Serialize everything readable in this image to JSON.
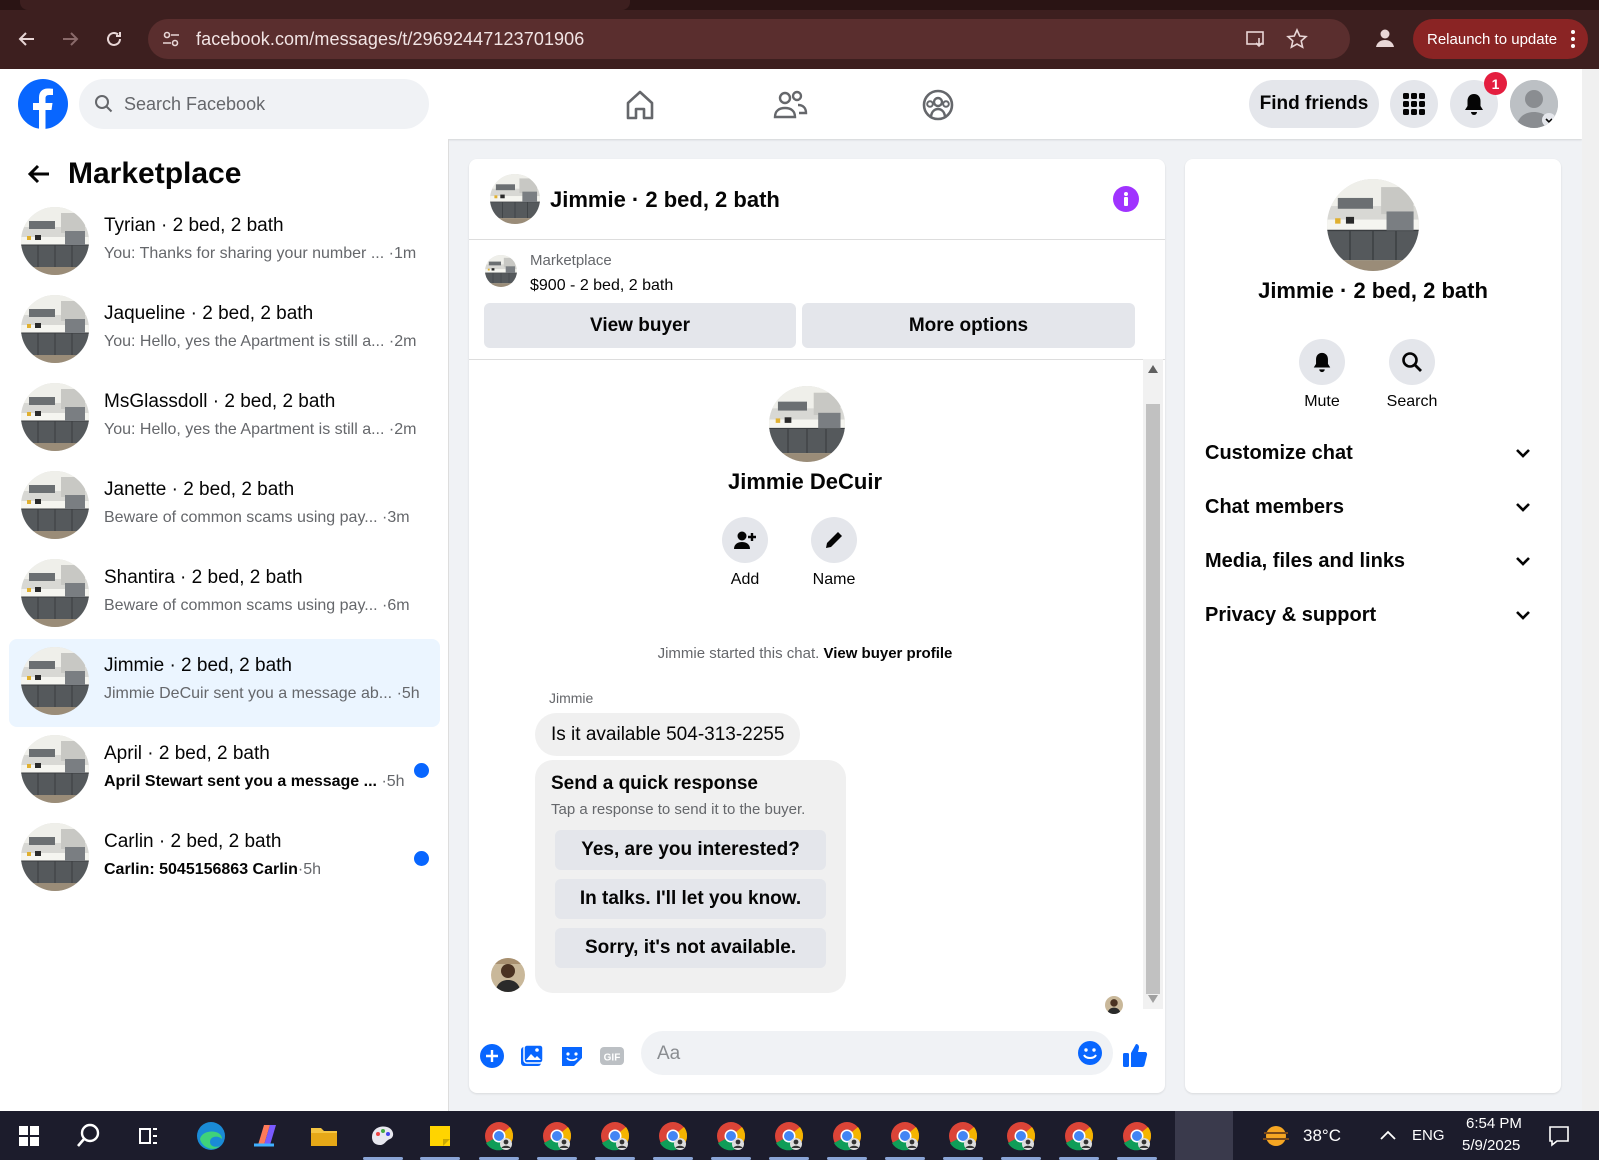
{
  "browser": {
    "url": "facebook.com/messages/t/29692447123701906",
    "relaunch_label": "Relaunch to update"
  },
  "fb": {
    "search_placeholder": "Search Facebook",
    "find_friends": "Find friends",
    "notification_count": "1"
  },
  "sidebar": {
    "title": "Marketplace",
    "conversations": [
      {
        "name": "Tyrian · 2 bed, 2 bath",
        "preview": "You: Thanks for sharing your number ... ",
        "time": "·1m",
        "unread": false,
        "active": false
      },
      {
        "name": "Jaqueline · 2 bed, 2 bath",
        "preview": "You: Hello, yes the Apartment is still a... ",
        "time": "·2m",
        "unread": false,
        "active": false
      },
      {
        "name": "MsGlassdoll · 2 bed, 2 bath",
        "preview": "You: Hello, yes the Apartment is still a... ",
        "time": "·2m",
        "unread": false,
        "active": false
      },
      {
        "name": "Janette · 2 bed, 2 bath",
        "preview": "Beware of common scams using pay... ",
        "time": "·3m",
        "unread": false,
        "active": false
      },
      {
        "name": "Shantira · 2 bed, 2 bath",
        "preview": "Beware of common scams using pay... ",
        "time": "·6m",
        "unread": false,
        "active": false
      },
      {
        "name": "Jimmie · 2 bed, 2 bath",
        "preview": "Jimmie DeCuir sent you a message ab... ",
        "time": "·5h",
        "unread": false,
        "active": true
      },
      {
        "name": "April · 2 bed, 2 bath",
        "preview": "April Stewart sent you a message ... ",
        "time": "·5h",
        "unread": true,
        "active": false
      },
      {
        "name": "Carlin · 2 bed, 2 bath",
        "preview": "Carlin: 5045156863 Carlin",
        "time": "·5h",
        "unread": true,
        "active": false
      }
    ]
  },
  "chat": {
    "header_name": "Jimmie · 2 bed, 2 bath",
    "listing_category": "Marketplace",
    "listing_price": "$900 - 2 bed, 2 bath",
    "view_buyer": "View buyer",
    "more_options": "More options",
    "profile_name": "Jimmie DeCuir",
    "add_label": "Add",
    "name_label": "Name",
    "started_text": "Jimmie started this chat. ",
    "view_buyer_profile": "View buyer profile",
    "sender_name": "Jimmie",
    "message": "Is it available 504-313-2255",
    "quick_title": "Send a quick response",
    "quick_sub": "Tap a response to send it to the buyer.",
    "quick_options": [
      "Yes, are you interested?",
      "In talks. I'll let you know.",
      "Sorry, it's not available."
    ],
    "composer_placeholder": "Aa"
  },
  "details": {
    "name": "Jimmie · 2 bed, 2 bath",
    "mute": "Mute",
    "search": "Search",
    "sections": [
      "Customize chat",
      "Chat members",
      "Media, files and links",
      "Privacy & support"
    ]
  },
  "taskbar": {
    "temperature": "38°C",
    "language": "ENG",
    "time": "6:54 PM",
    "date": "5/9/2025"
  },
  "colors": {
    "fb_blue": "#0866ff",
    "info_purple": "#a033ff",
    "chrome_bg": "#3d1f1f",
    "relaunch_bg": "#8a2424",
    "active_row": "#ebf5ff"
  }
}
